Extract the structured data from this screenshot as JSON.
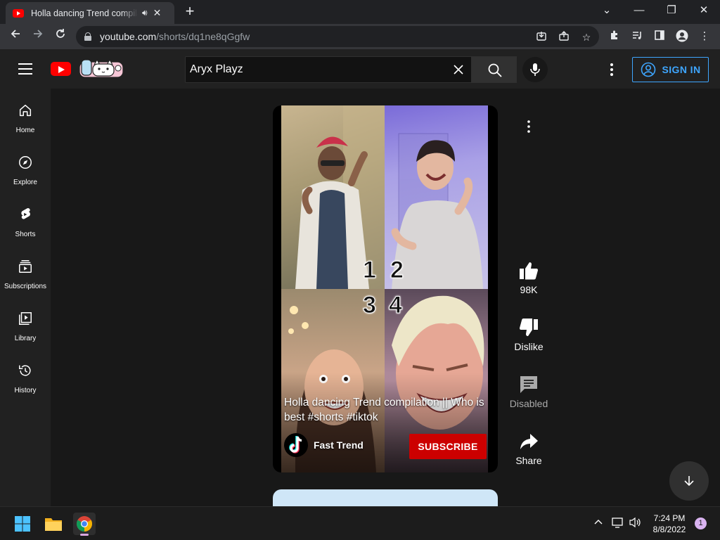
{
  "browser": {
    "tab_title": "Holla dancing Trend compilation || Who is best #shorts #tiktok",
    "url_host": "youtube.com",
    "url_path": "/shorts/dq1ne8qGgfw",
    "new_tab": "+",
    "minimize": "—",
    "restore": "❐",
    "close": "✕"
  },
  "header": {
    "search_value": "Aryx Playz",
    "sign_in": "SIGN IN"
  },
  "sidebar": {
    "items": [
      {
        "label": "Home",
        "icon": "home-icon"
      },
      {
        "label": "Explore",
        "icon": "compass-icon"
      },
      {
        "label": "Shorts",
        "icon": "shorts-icon"
      },
      {
        "label": "Subscriptions",
        "icon": "subscriptions-icon"
      },
      {
        "label": "Library",
        "icon": "library-icon"
      },
      {
        "label": "History",
        "icon": "history-icon"
      }
    ]
  },
  "short": {
    "title": "Holla dancing Trend compilation || Who is best #shorts #tiktok",
    "channel": "Fast Trend",
    "subscribe": "SUBSCRIBE",
    "numbers": [
      "1",
      "2",
      "3",
      "4"
    ],
    "likes": "98K",
    "dislike": "Dislike",
    "comments": "Disabled",
    "share": "Share"
  },
  "taskbar": {
    "time": "7:24 PM",
    "date": "8/8/2022",
    "notifications": "1"
  },
  "colors": {
    "accent_blue": "#3ea6ff",
    "subscribe_red": "#cc0000",
    "youtube_red": "#ff0000"
  }
}
